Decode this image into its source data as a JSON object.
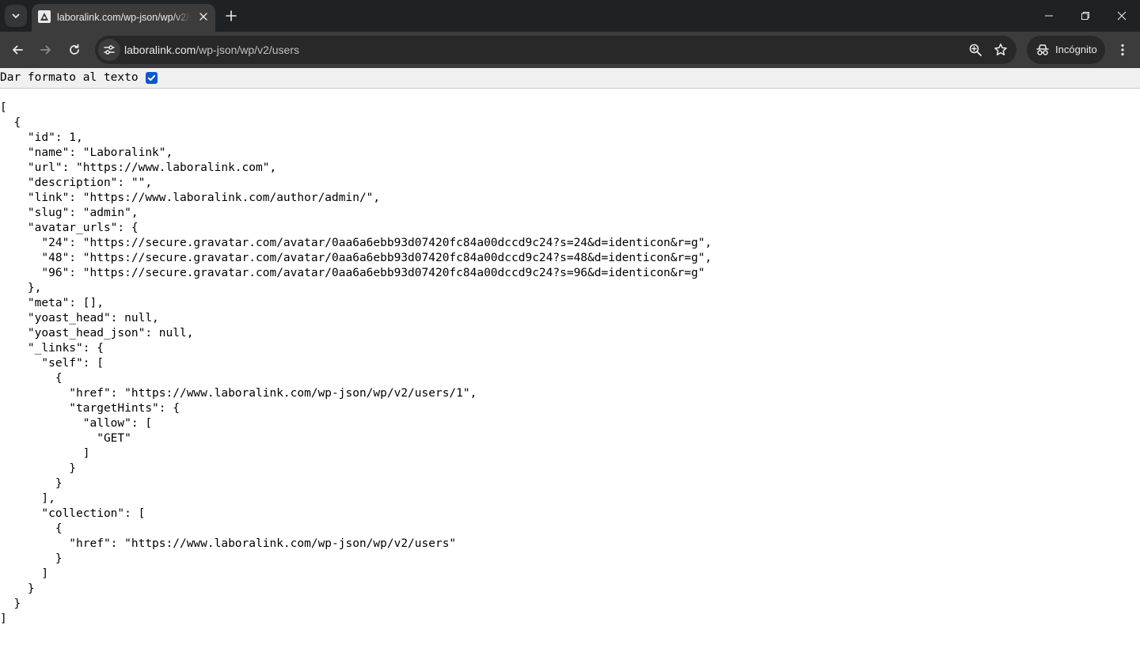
{
  "browser": {
    "tab_title": "laboralink.com/wp-json/wp/v2/users",
    "url_host": "laboralink.com",
    "url_path": "/wp-json/wp/v2/users",
    "incognito_label": "Incógnito"
  },
  "viewer": {
    "format_label": "Dar formato al texto",
    "format_checked": true,
    "json_lines": [
      "[",
      "  {",
      "    \"id\": 1,",
      "    \"name\": \"Laboralink\",",
      "    \"url\": \"https://www.laboralink.com\",",
      "    \"description\": \"\",",
      "    \"link\": \"https://www.laboralink.com/author/admin/\",",
      "    \"slug\": \"admin\",",
      "    \"avatar_urls\": {",
      "      \"24\": \"https://secure.gravatar.com/avatar/0aa6a6ebb93d07420fc84a00dccd9c24?s=24&d=identicon&r=g\",",
      "      \"48\": \"https://secure.gravatar.com/avatar/0aa6a6ebb93d07420fc84a00dccd9c24?s=48&d=identicon&r=g\",",
      "      \"96\": \"https://secure.gravatar.com/avatar/0aa6a6ebb93d07420fc84a00dccd9c24?s=96&d=identicon&r=g\"",
      "    },",
      "    \"meta\": [],",
      "    \"yoast_head\": null,",
      "    \"yoast_head_json\": null,",
      "    \"_links\": {",
      "      \"self\": [",
      "        {",
      "          \"href\": \"https://www.laboralink.com/wp-json/wp/v2/users/1\",",
      "          \"targetHints\": {",
      "            \"allow\": [",
      "              \"GET\"",
      "            ]",
      "          }",
      "        }",
      "      ],",
      "      \"collection\": [",
      "        {",
      "          \"href\": \"https://www.laboralink.com/wp-json/wp/v2/users\"",
      "        }",
      "      ]",
      "    }",
      "  }",
      "]"
    ]
  }
}
